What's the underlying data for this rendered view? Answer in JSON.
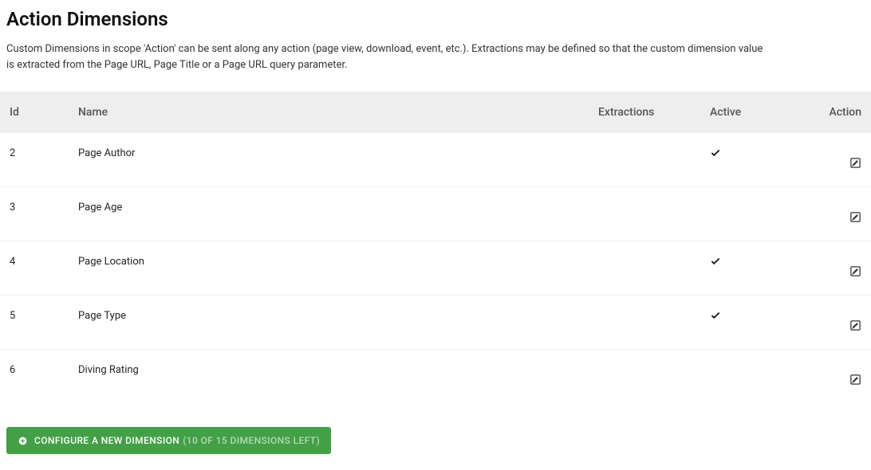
{
  "page": {
    "title": "Action Dimensions",
    "description": "Custom Dimensions in scope 'Action' can be sent along any action (page view, download, event, etc.). Extractions may be defined so that the custom dimension value is extracted from the Page URL, Page Title or a Page URL query parameter."
  },
  "table": {
    "headers": {
      "id": "Id",
      "name": "Name",
      "extractions": "Extractions",
      "active": "Active",
      "action": "Action"
    },
    "rows": [
      {
        "id": "2",
        "name": "Page Author",
        "extractions": "",
        "active": true
      },
      {
        "id": "3",
        "name": "Page Age",
        "extractions": "",
        "active": false
      },
      {
        "id": "4",
        "name": "Page Location",
        "extractions": "",
        "active": true
      },
      {
        "id": "5",
        "name": "Page Type",
        "extractions": "",
        "active": true
      },
      {
        "id": "6",
        "name": "Diving Rating",
        "extractions": "",
        "active": false
      }
    ]
  },
  "button": {
    "main": "CONFIGURE A NEW DIMENSION",
    "secondary": "(10 OF 15 DIMENSIONS LEFT)"
  }
}
